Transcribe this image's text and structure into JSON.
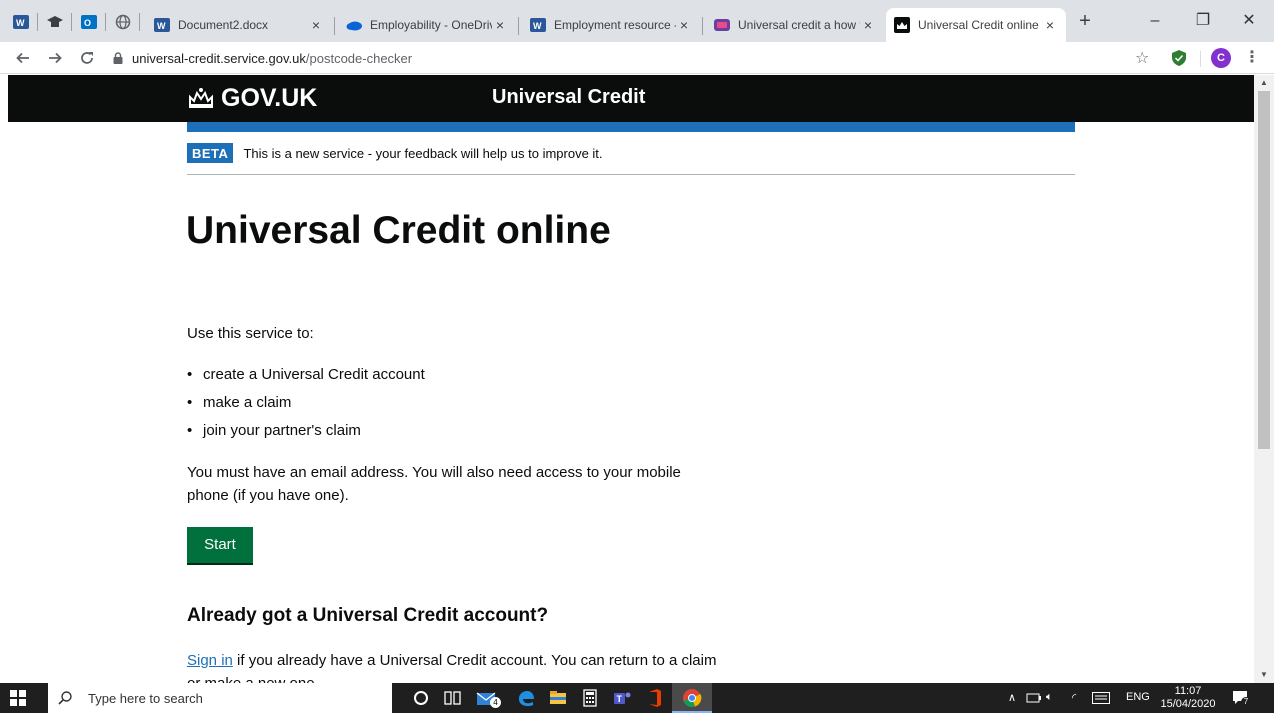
{
  "browser": {
    "tabs": [
      {
        "title": "Document2.docx",
        "icon": "word-icon",
        "active": false
      },
      {
        "title": "Employability - OneDrive",
        "icon": "onedrive-icon",
        "active": false
      },
      {
        "title": "Employment resource - I",
        "icon": "word-icon",
        "active": false
      },
      {
        "title": "Universal credit a how to",
        "icon": "video-icon",
        "active": false
      },
      {
        "title": "Universal Credit online -",
        "icon": "govuk-crown-icon",
        "active": true
      }
    ],
    "tab_close_glyph": "×",
    "new_tab_glyph": "+",
    "address": {
      "host": "universal-credit.service.gov.uk",
      "path": "/postcode-checker"
    },
    "profile_initial": "C",
    "window_controls": {
      "minimize": "–",
      "restore": "❐",
      "close": "✕"
    }
  },
  "page": {
    "logo_text": "GOV.UK",
    "service_name": "Universal Credit",
    "phase_tag": "BETA",
    "phase_text": "This is a new service - your feedback will help us to improve it.",
    "heading": "Universal Credit online",
    "lead": "Use this service to:",
    "bullets": [
      "create a Universal Credit account",
      "make a claim",
      "join your partner's claim"
    ],
    "requirements": "You must have an email address. You will also need access to your mobile phone (if you have one).",
    "start_button": "Start",
    "account_heading": "Already got a Universal Credit account?",
    "signin_link": "Sign in",
    "signin_text": " if you already have a Universal Credit account. You can return to a claim or make a new one."
  },
  "taskbar": {
    "search_placeholder": "Type here to search",
    "mail_badge": "4",
    "tray": {
      "language": "ENG"
    },
    "clock": {
      "time": "11:07",
      "date": "15/04/2020"
    },
    "notification_count": "7"
  },
  "colors": {
    "gov_black": "#0b0c0c",
    "gov_blue": "#1d70b8",
    "gov_green": "#00703c",
    "tab_strip": "#dee1e6"
  }
}
